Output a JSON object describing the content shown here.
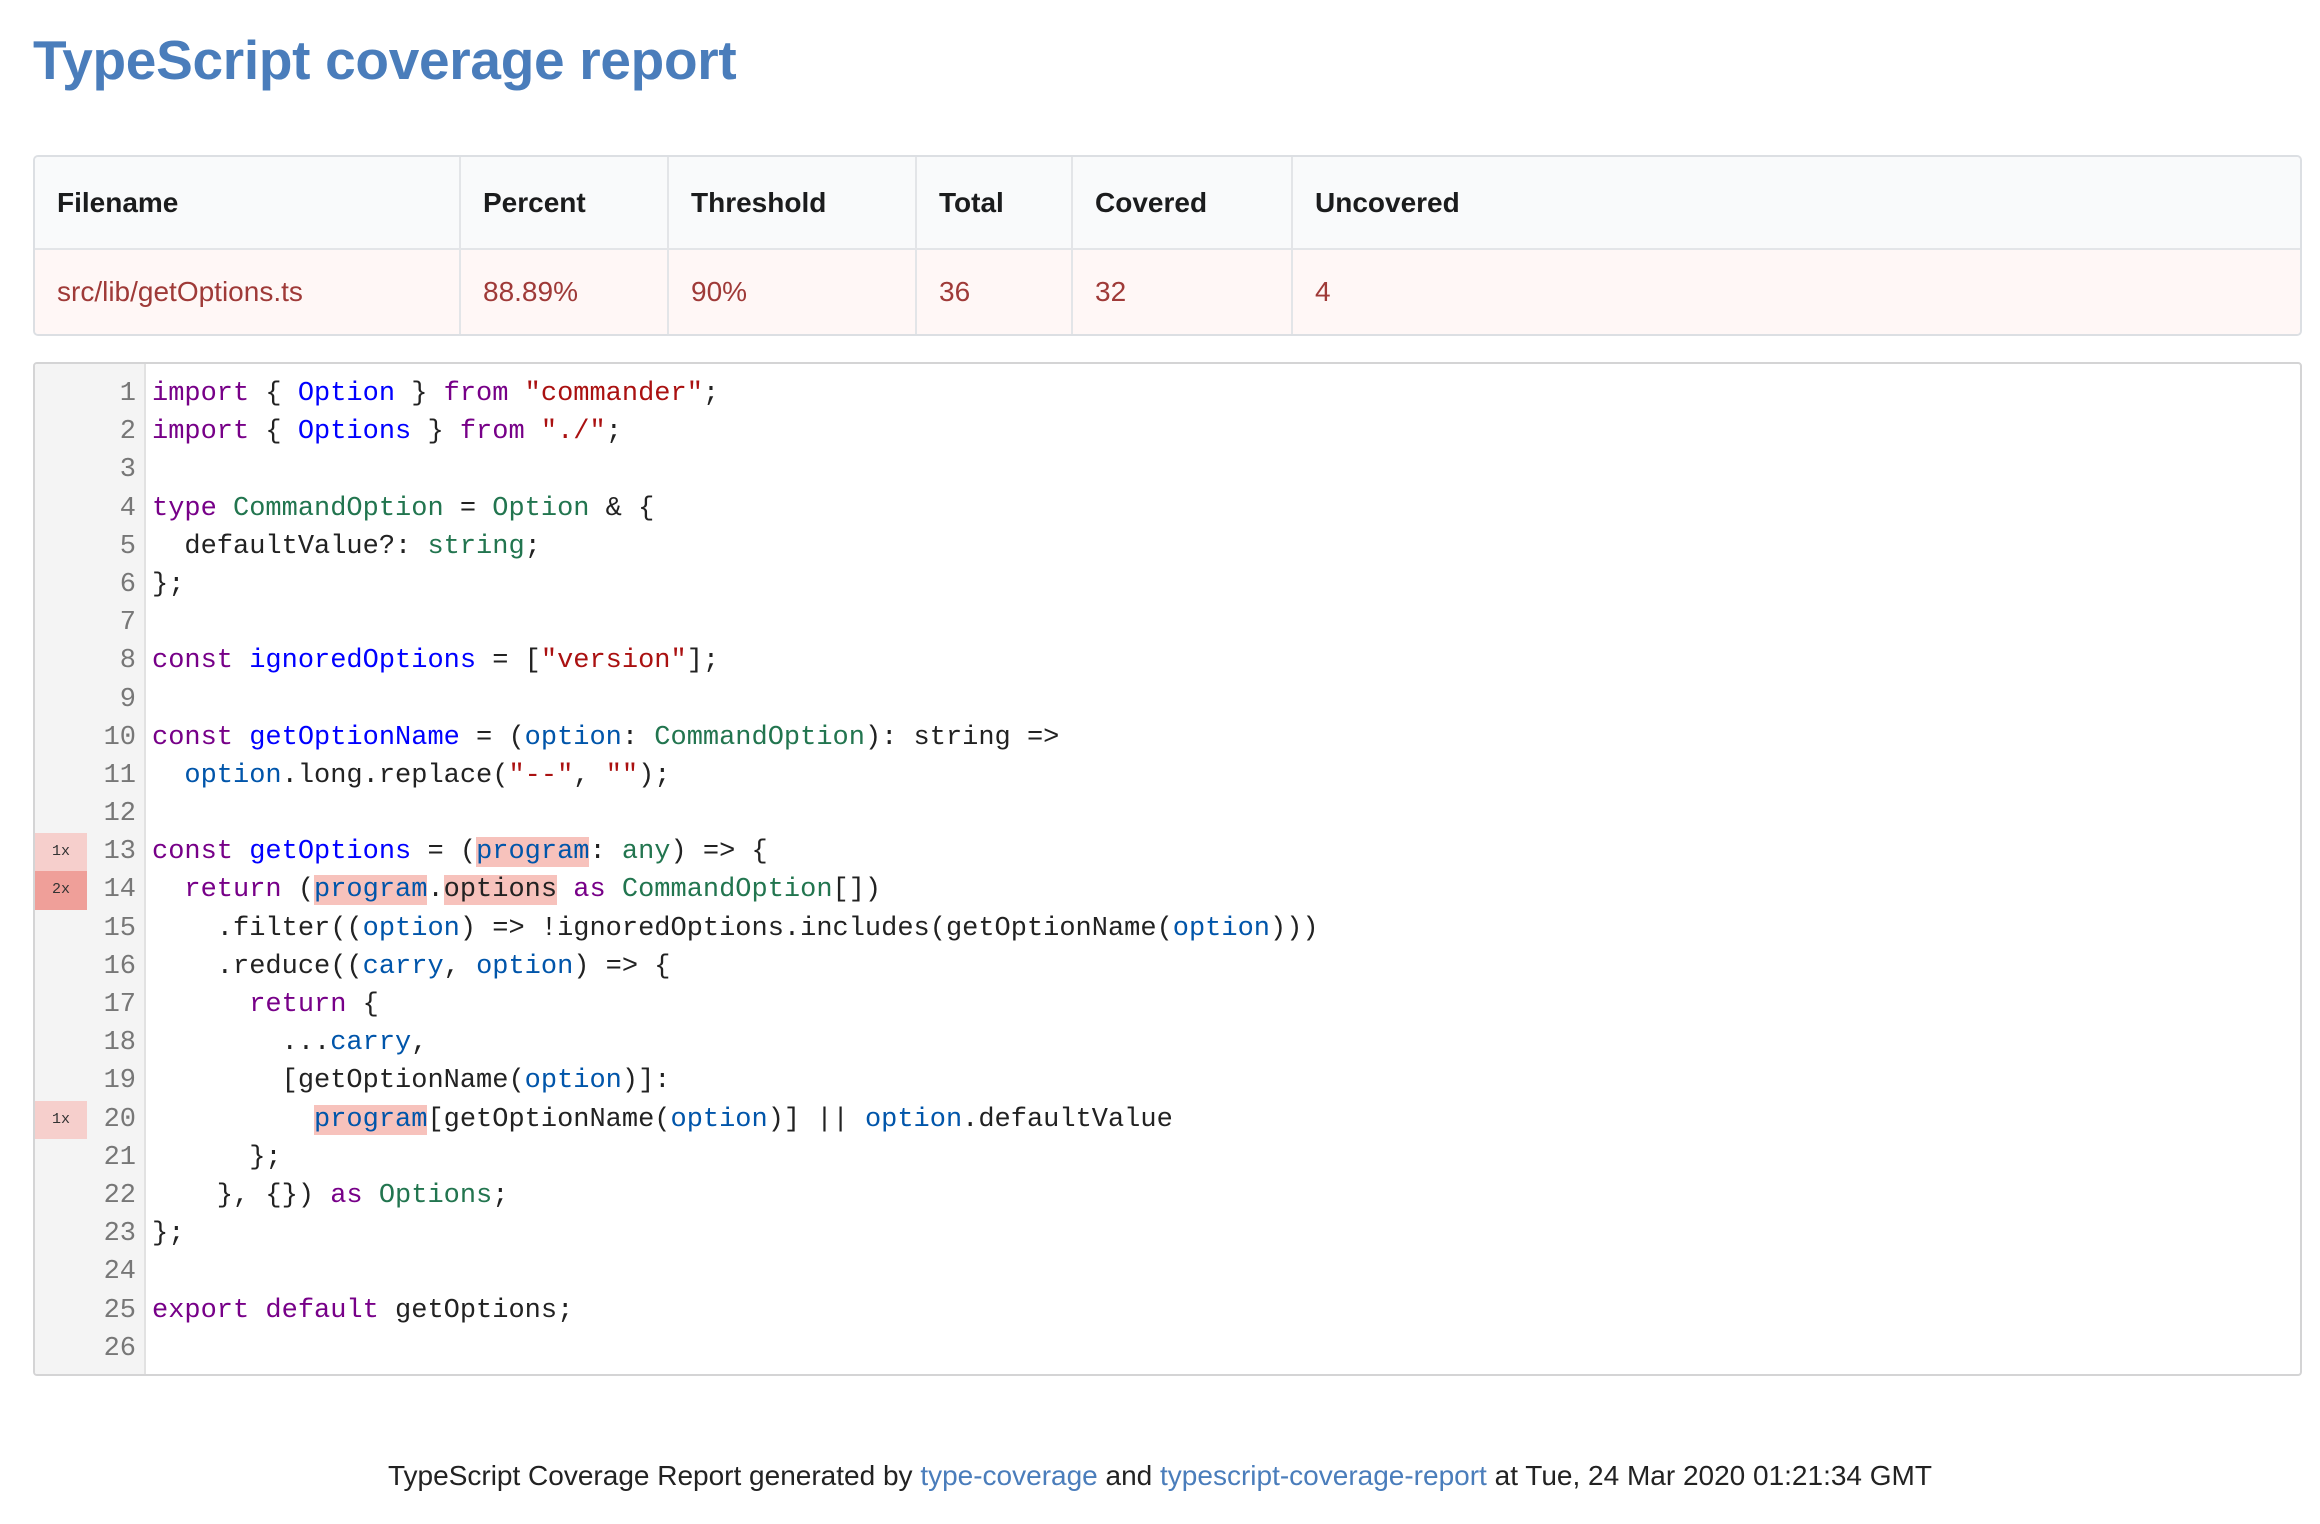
{
  "page": {
    "title": "TypeScript coverage report"
  },
  "summary": {
    "columns": [
      "Filename",
      "Percent",
      "Threshold",
      "Total",
      "Covered",
      "Uncovered"
    ],
    "rows": [
      {
        "filename": "src/lib/getOptions.ts",
        "percent": "88.89%",
        "threshold": "90%",
        "total": "36",
        "covered": "32",
        "uncovered": "4"
      }
    ]
  },
  "code": {
    "hits": {
      "13": "1x",
      "14": "2x",
      "20": "1x"
    },
    "lines": [
      [
        [
          "kw",
          "import"
        ],
        [
          "op",
          " { "
        ],
        [
          "def",
          "Option"
        ],
        [
          "op",
          " } "
        ],
        [
          "kw",
          "from"
        ],
        [
          "op",
          " "
        ],
        [
          "str",
          "\"commander\""
        ],
        [
          "op",
          ";"
        ]
      ],
      [
        [
          "kw",
          "import"
        ],
        [
          "op",
          " { "
        ],
        [
          "def",
          "Options"
        ],
        [
          "op",
          " } "
        ],
        [
          "kw",
          "from"
        ],
        [
          "op",
          " "
        ],
        [
          "str",
          "\"./\""
        ],
        [
          "op",
          ";"
        ]
      ],
      [],
      [
        [
          "kw",
          "type"
        ],
        [
          "op",
          " "
        ],
        [
          "type",
          "CommandOption"
        ],
        [
          "op",
          " = "
        ],
        [
          "type",
          "Option"
        ],
        [
          "op",
          " & {"
        ]
      ],
      [
        [
          "op",
          "  defaultValue?: "
        ],
        [
          "type",
          "string"
        ],
        [
          "op",
          ";"
        ]
      ],
      [
        [
          "op",
          "};"
        ]
      ],
      [],
      [
        [
          "kw",
          "const"
        ],
        [
          "op",
          " "
        ],
        [
          "def",
          "ignoredOptions"
        ],
        [
          "op",
          " = ["
        ],
        [
          "str",
          "\"version\""
        ],
        [
          "op",
          "];"
        ]
      ],
      [],
      [
        [
          "kw",
          "const"
        ],
        [
          "op",
          " "
        ],
        [
          "def",
          "getOptionName"
        ],
        [
          "op",
          " = ("
        ],
        [
          "var2",
          "option"
        ],
        [
          "op",
          ": "
        ],
        [
          "type",
          "CommandOption"
        ],
        [
          "op",
          "): string =>"
        ]
      ],
      [
        [
          "op",
          "  "
        ],
        [
          "var2",
          "option"
        ],
        [
          "op",
          ".long.replace("
        ],
        [
          "str",
          "\"--\""
        ],
        [
          "op",
          ", "
        ],
        [
          "str",
          "\"\""
        ],
        [
          "op",
          ");"
        ]
      ],
      [],
      [
        [
          "kw",
          "const"
        ],
        [
          "op",
          " "
        ],
        [
          "def",
          "getOptions"
        ],
        [
          "op",
          " = ("
        ],
        [
          "var2 unc",
          "program"
        ],
        [
          "op",
          ": "
        ],
        [
          "type",
          "any"
        ],
        [
          "op",
          ") => {"
        ]
      ],
      [
        [
          "op",
          "  "
        ],
        [
          "kw",
          "return"
        ],
        [
          "op",
          " ("
        ],
        [
          "var2 unc",
          "program"
        ],
        [
          "op",
          "."
        ],
        [
          "op unc",
          "options"
        ],
        [
          "op",
          " "
        ],
        [
          "kw",
          "as"
        ],
        [
          "op",
          " "
        ],
        [
          "type",
          "CommandOption"
        ],
        [
          "op",
          "[])"
        ]
      ],
      [
        [
          "op",
          "    .filter(("
        ],
        [
          "var2",
          "option"
        ],
        [
          "op",
          ") => !ignoredOptions.includes(getOptionName("
        ],
        [
          "var2",
          "option"
        ],
        [
          "op",
          ")))"
        ]
      ],
      [
        [
          "op",
          "    .reduce(("
        ],
        [
          "var2",
          "carry"
        ],
        [
          "op",
          ", "
        ],
        [
          "var2",
          "option"
        ],
        [
          "op",
          ") => {"
        ]
      ],
      [
        [
          "op",
          "      "
        ],
        [
          "kw",
          "return"
        ],
        [
          "op",
          " {"
        ]
      ],
      [
        [
          "op",
          "        ..."
        ],
        [
          "var2",
          "carry"
        ],
        [
          "op",
          ","
        ]
      ],
      [
        [
          "op",
          "        [getOptionName("
        ],
        [
          "var2",
          "option"
        ],
        [
          "op",
          ")]:"
        ]
      ],
      [
        [
          "op",
          "          "
        ],
        [
          "var2 unc",
          "program"
        ],
        [
          "op",
          "[getOptionName("
        ],
        [
          "var2",
          "option"
        ],
        [
          "op",
          ")] || "
        ],
        [
          "var2",
          "option"
        ],
        [
          "op",
          ".defaultValue"
        ]
      ],
      [
        [
          "op",
          "      };"
        ]
      ],
      [
        [
          "op",
          "    }, {}) "
        ],
        [
          "kw",
          "as"
        ],
        [
          "op",
          " "
        ],
        [
          "type",
          "Options"
        ],
        [
          "op",
          ";"
        ]
      ],
      [
        [
          "op",
          "};"
        ]
      ],
      [],
      [
        [
          "kw",
          "export"
        ],
        [
          "op",
          " "
        ],
        [
          "kw",
          "default"
        ],
        [
          "op",
          " getOptions;"
        ]
      ],
      []
    ]
  },
  "footer": {
    "prefix": "TypeScript Coverage Report generated by ",
    "link1": "type-coverage",
    "middle": " and ",
    "link2": "typescript-coverage-report",
    "suffix": " at Tue, 24 Mar 2020 01:21:34 GMT"
  }
}
